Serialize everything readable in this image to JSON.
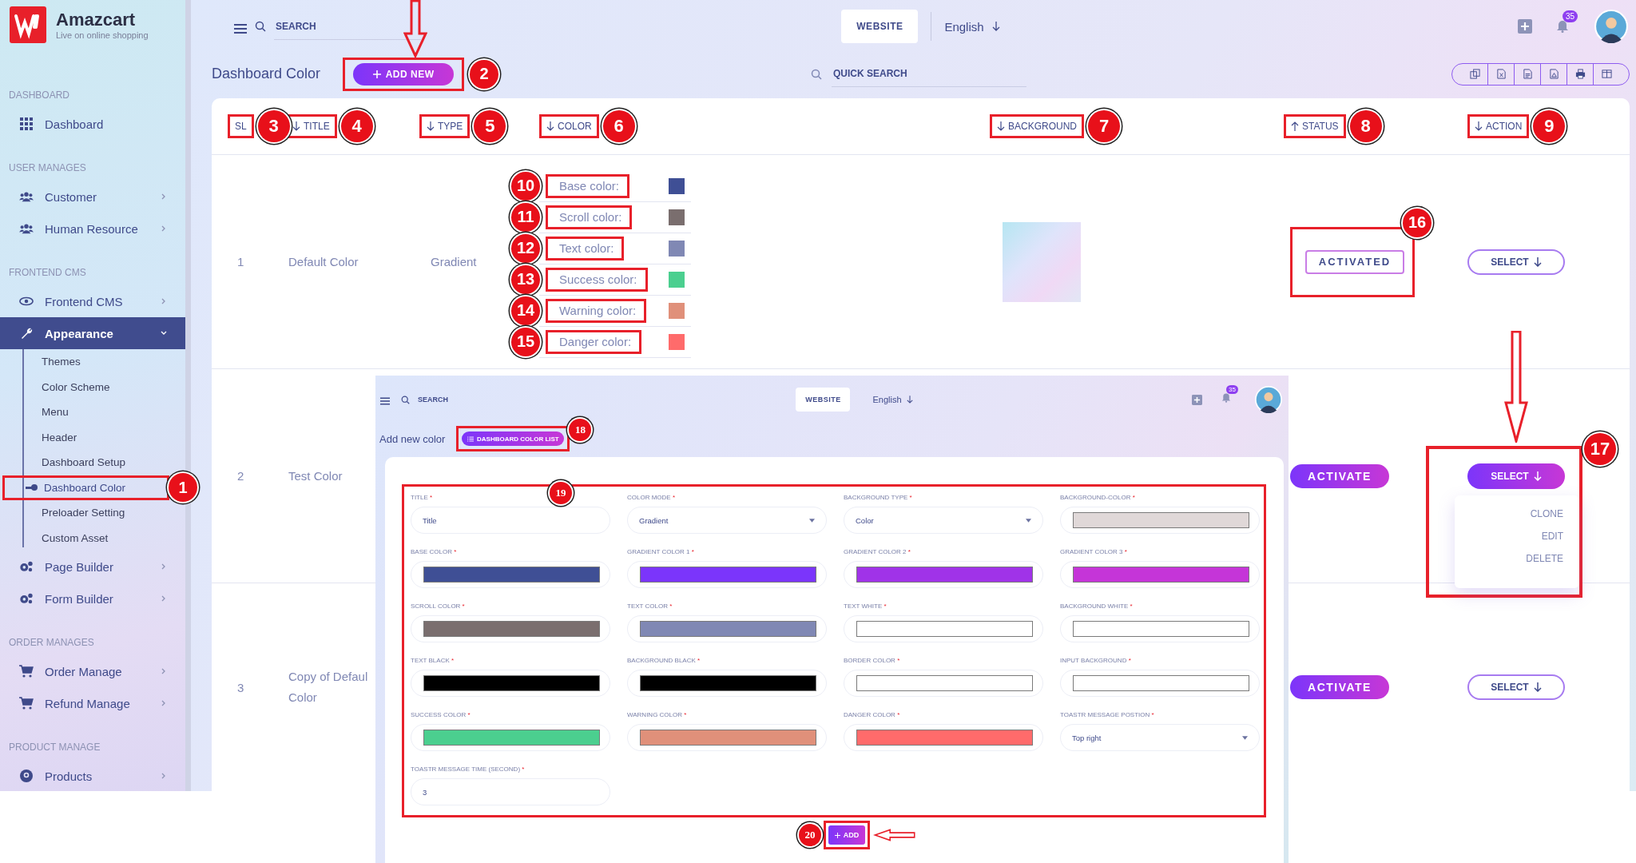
{
  "sidebar": {
    "brand": {
      "name": "Amazcart",
      "tagline": "Live on online shopping"
    },
    "sections": [
      {
        "heading": "DASHBOARD",
        "items": [
          {
            "label": "Dashboard",
            "kind": "grid",
            "submenu": false,
            "selected": false
          }
        ]
      },
      {
        "heading": "USER MANAGES",
        "items": [
          {
            "label": "Customer",
            "kind": "users",
            "submenu": true,
            "expanded": false,
            "selected": false
          },
          {
            "label": "Human Resource",
            "kind": "users",
            "submenu": true,
            "expanded": false,
            "selected": false
          }
        ]
      },
      {
        "heading": "FRONTEND CMS",
        "items": [
          {
            "label": "Frontend CMS",
            "kind": "eye",
            "submenu": true,
            "expanded": false,
            "selected": false
          },
          {
            "label": "Appearance",
            "kind": "wrench",
            "submenu": true,
            "expanded": true,
            "selected": true,
            "children": [
              {
                "label": "Themes",
                "selected": false
              },
              {
                "label": "Color Scheme",
                "selected": false
              },
              {
                "label": "Menu",
                "selected": false
              },
              {
                "label": "Header",
                "selected": false
              },
              {
                "label": "Dashboard Setup",
                "selected": false
              },
              {
                "label": "Dashboard Color",
                "selected": true,
                "callout": "1"
              },
              {
                "label": "Preloader Setting",
                "selected": false
              },
              {
                "label": "Custom Asset",
                "selected": false
              }
            ]
          },
          {
            "label": "Page Builder",
            "kind": "gears",
            "submenu": true,
            "expanded": false,
            "selected": false
          },
          {
            "label": "Form Builder",
            "kind": "gears",
            "submenu": true,
            "expanded": false,
            "selected": false
          }
        ]
      },
      {
        "heading": "ORDER MANAGES",
        "items": [
          {
            "label": "Order Manage",
            "kind": "cart",
            "submenu": true,
            "expanded": false,
            "selected": false
          },
          {
            "label": "Refund Manage",
            "kind": "cart",
            "submenu": true,
            "expanded": false,
            "selected": false
          }
        ]
      },
      {
        "heading": "PRODUCT MANAGE",
        "items": [
          {
            "label": "Products",
            "kind": "badge",
            "submenu": true,
            "expanded": false,
            "selected": false
          }
        ]
      }
    ]
  },
  "header": {
    "search": {
      "placeholder": "SEARCH"
    },
    "website_button": "WEBSITE",
    "language": "English",
    "notifications": "35"
  },
  "page": {
    "title": "Dashboard Color",
    "add_button": {
      "label": "ADD NEW",
      "callout": "2"
    },
    "quick_search": {
      "placeholder": "QUICK SEARCH"
    }
  },
  "table": {
    "columns": [
      {
        "label": "SL",
        "sortable": false,
        "callout": "3"
      },
      {
        "label": "TITLE",
        "sortable": true,
        "ascending": false,
        "callout": "4"
      },
      {
        "label": "TYPE",
        "sortable": true,
        "ascending": false,
        "callout": "5"
      },
      {
        "label": "COLOR",
        "sortable": true,
        "ascending": false,
        "callout": "6"
      },
      {
        "label": "BACKGROUND",
        "sortable": true,
        "ascending": false,
        "callout": "7"
      },
      {
        "label": "STATUS",
        "sortable": true,
        "ascending": true,
        "callout": "8"
      },
      {
        "label": "ACTION",
        "sortable": true,
        "ascending": false,
        "callout": "9"
      }
    ],
    "rows": [
      {
        "sl": "1",
        "title": "Default Color",
        "type": "Gradient",
        "colors": [
          {
            "label": "Base color:",
            "color": "#3f4f95",
            "callout": "10"
          },
          {
            "label": "Scroll color:",
            "color": "#7a6e6e",
            "callout": "11"
          },
          {
            "label": "Text color:",
            "color": "#8088b4",
            "callout": "12"
          },
          {
            "label": "Success color:",
            "color": "#4bcf8f",
            "callout": "13"
          },
          {
            "label": "Warning color:",
            "color": "#e0907a",
            "callout": "14"
          },
          {
            "label": "Danger color:",
            "color": "#ff6b6b",
            "callout": "15"
          }
        ],
        "background_image": true,
        "status": {
          "label": "ACTIVATED",
          "active": true,
          "callout": "16"
        },
        "action": {
          "label": "SELECT",
          "open": false
        }
      },
      {
        "sl": "2",
        "title": "Test Color",
        "status": {
          "label": "ACTIVATE",
          "active": false
        },
        "action": {
          "label": "SELECT",
          "open": true,
          "callout": "17",
          "menu": [
            "CLONE",
            "EDIT",
            "DELETE"
          ]
        }
      },
      {
        "sl": "3",
        "title": "Copy of Defaul Color",
        "status": {
          "label": "ACTIVATE",
          "active": false
        },
        "action": {
          "label": "SELECT",
          "open": false
        }
      }
    ]
  },
  "inset": {
    "search": {
      "placeholder": "SEARCH"
    },
    "website_button": "WEBSITE",
    "language": "English",
    "notifications": "35",
    "title": "Add new color",
    "list_button": {
      "label": "DASHBOARD COLOR LIST",
      "callout": "18"
    },
    "form": {
      "callout": "19",
      "fields": [
        {
          "label": "TITLE",
          "required": "*",
          "kind": "text",
          "placeholder": "Title"
        },
        {
          "label": "COLOR MODE",
          "required": "*",
          "kind": "select",
          "value": "Gradient"
        },
        {
          "label": "BACKGROUND TYPE",
          "required": "*",
          "kind": "select",
          "value": "Color"
        },
        {
          "label": "BACKGROUND-COLOR",
          "required": "*",
          "kind": "color",
          "color": "#e0d8d8"
        },
        {
          "label": "BASE COLOR",
          "required": "*",
          "kind": "color",
          "color": "#3f4f95"
        },
        {
          "label": "GRADIENT COLOR 1",
          "required": "*",
          "kind": "color",
          "color": "#7b35fb"
        },
        {
          "label": "GRADIENT COLOR 2",
          "required": "*",
          "kind": "color",
          "color": "#a033e8"
        },
        {
          "label": "GRADIENT COLOR 3",
          "required": "*",
          "kind": "color",
          "color": "#c535d8"
        },
        {
          "label": "SCROLL COLOR",
          "required": "*",
          "kind": "color",
          "color": "#7a6e6e"
        },
        {
          "label": "TEXT COLOR",
          "required": "*",
          "kind": "color",
          "color": "#8088b4"
        },
        {
          "label": "TEXT WHITE",
          "required": "*",
          "kind": "color",
          "color": "#ffffff"
        },
        {
          "label": "BACKGROUND WHITE",
          "required": "*",
          "kind": "color",
          "color": "#ffffff"
        },
        {
          "label": "TEXT BLACK",
          "required": "*",
          "kind": "color",
          "color": "#000000"
        },
        {
          "label": "BACKGROUND BLACK",
          "required": "*",
          "kind": "color",
          "color": "#000000"
        },
        {
          "label": "BORDER COLOR",
          "required": "*",
          "kind": "color",
          "color": "#ffffff"
        },
        {
          "label": "INPUT BACKGROUND",
          "required": "*",
          "kind": "color",
          "color": "#ffffff"
        },
        {
          "label": "SUCCESS COLOR",
          "required": "*",
          "kind": "color",
          "color": "#4bcf8f"
        },
        {
          "label": "WARNING COLOR",
          "required": "*",
          "kind": "color",
          "color": "#e0907a"
        },
        {
          "label": "DANGER COLOR",
          "required": "*",
          "kind": "color",
          "color": "#ff6b6b"
        },
        {
          "label": "TOASTR MESSAGE POSTION",
          "required": "*",
          "kind": "select",
          "value": "Top right"
        },
        {
          "label": "TOASTR MESSAGE TIME (SECOND)",
          "required": "*",
          "kind": "text",
          "value": "3"
        }
      ]
    },
    "add_button": {
      "label": "ADD",
      "callout": "20"
    }
  }
}
